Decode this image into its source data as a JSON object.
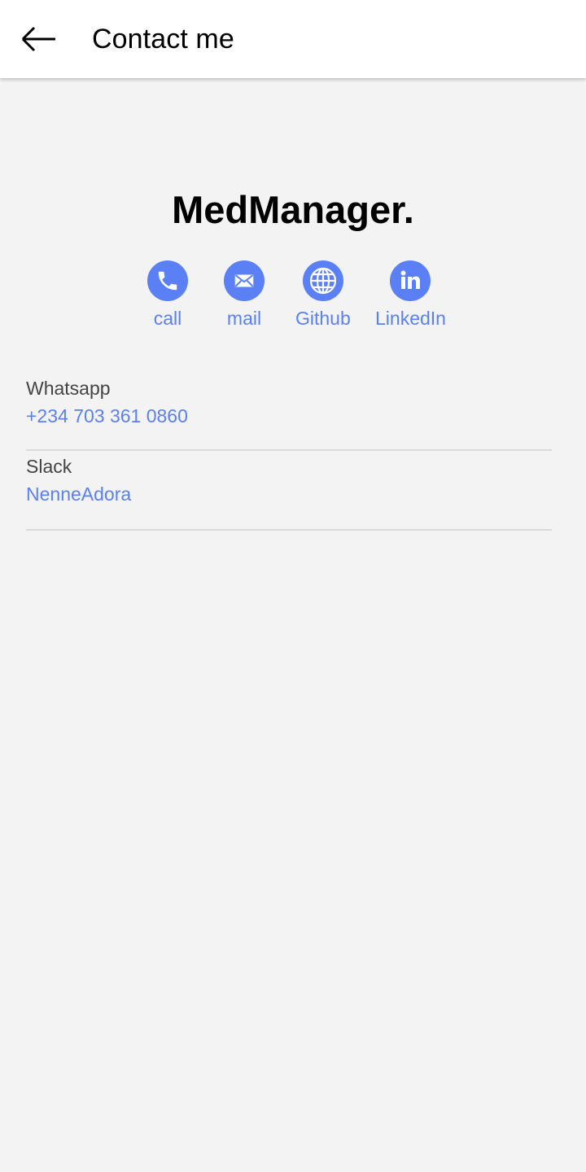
{
  "header": {
    "title": "Contact me",
    "back_icon": "arrow-left-icon"
  },
  "brand": "MedManager.",
  "actions": [
    {
      "label": "call",
      "icon": "phone-icon"
    },
    {
      "label": "mail",
      "icon": "mail-icon"
    },
    {
      "label": "Github",
      "icon": "globe-icon"
    },
    {
      "label": "LinkedIn",
      "icon": "linkedin-icon"
    }
  ],
  "contacts": [
    {
      "title": "Whatsapp",
      "value": "+234 703 361 0860"
    },
    {
      "title": "Slack",
      "value": "NenneAdora"
    }
  ],
  "colors": {
    "accent": "#5b80f5",
    "background": "#f3f3f3",
    "app_bar": "#ffffff",
    "divider": "#d9d9d9"
  }
}
